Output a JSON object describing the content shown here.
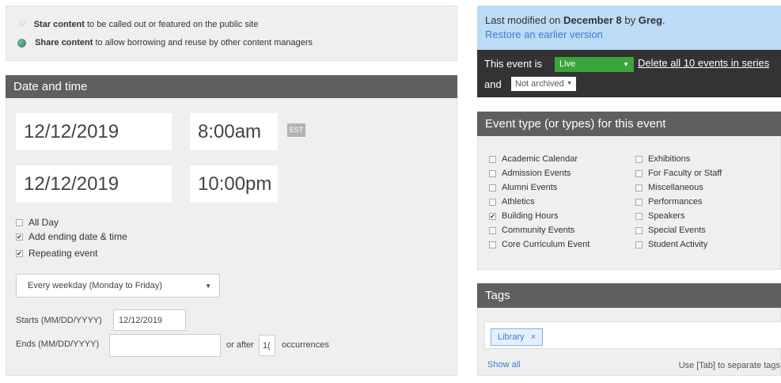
{
  "promo": {
    "star_bold": "Star content",
    "star_rest": " to be called out or featured on the public site",
    "share_bold": "Share content",
    "share_rest": " to allow borrowing and reuse by other content managers"
  },
  "datetime": {
    "header": "Date and time",
    "start_date": "12/12/2019",
    "start_time": "8:00am",
    "timezone": "EST",
    "end_date": "12/12/2019",
    "end_time": "10:00pm",
    "all_day": "All Day",
    "add_ending": "Add ending date & time",
    "repeating": "Repeating event",
    "repeat_select": "Every weekday (Monday to Friday)",
    "starts_label": "Starts (MM/DD/YYYY)",
    "starts_value": "12/12/2019",
    "ends_label": "Ends (MM/DD/YYYY)",
    "ends_value": "",
    "or_after": "or after",
    "occurrences_value": "1(",
    "occurrences": "occurrences"
  },
  "status": {
    "modified_prefix": "Last modified on ",
    "modified_date": "December 8",
    "modified_by": " by ",
    "modified_user": "Greg",
    "modified_end": ".",
    "restore": "Restore an earlier version",
    "event_is": "This event is",
    "live": "Live",
    "delete_all": "Delete all 10 events in series",
    "and": "and",
    "archived": "Not archived"
  },
  "event_types": {
    "header": "Event type (or types) for this event",
    "col1": [
      "Academic Calendar",
      "Admission Events",
      "Alumni Events",
      "Athletics",
      "Building Hours",
      "Community Events",
      "Core Curriculum Event"
    ],
    "col2": [
      "Exhibitions",
      "For Faculty or Staff",
      "Miscellaneous",
      "Performances",
      "Speakers",
      "Special Events",
      "Student Activity"
    ]
  },
  "tags": {
    "header": "Tags",
    "tag": "Library",
    "remove": "×",
    "show_all": "Show all",
    "hint": "Use [Tab] to separate tags"
  },
  "colors": {
    "live_green": "#3aa53a",
    "status_blue": "#bcdcf5",
    "header_gray": "#5f5f5f"
  }
}
